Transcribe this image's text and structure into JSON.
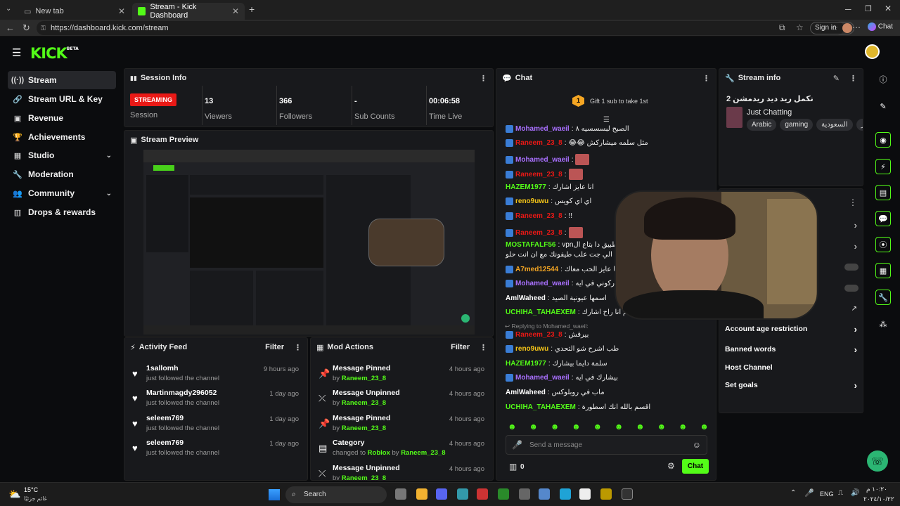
{
  "browser": {
    "tabs": [
      {
        "title": "New tab"
      },
      {
        "title": "Stream - Kick Dashboard"
      }
    ],
    "url": "https://dashboard.kick.com/stream",
    "sign_in": "Sign in",
    "chat_btn": "Chat"
  },
  "logo": {
    "text": "KICK",
    "beta": "BETA"
  },
  "sidebar": {
    "items": [
      {
        "label": "Stream",
        "icon": "broadcast-icon"
      },
      {
        "label": "Stream URL & Key",
        "icon": "link-icon"
      },
      {
        "label": "Revenue",
        "icon": "money-icon"
      },
      {
        "label": "Achievements",
        "icon": "trophy-icon"
      },
      {
        "label": "Studio",
        "icon": "grid-icon"
      },
      {
        "label": "Moderation",
        "icon": "wrench-icon"
      },
      {
        "label": "Community",
        "icon": "people-icon"
      },
      {
        "label": "Drops & rewards",
        "icon": "gift-icon"
      }
    ]
  },
  "session": {
    "title": "Session Info",
    "status": "STREAMING",
    "status_label": "Session",
    "stats": [
      {
        "value": "13",
        "label": "Viewers"
      },
      {
        "value": "366",
        "label": "Followers"
      },
      {
        "value": "-",
        "label": "Sub Counts"
      },
      {
        "value": "00:06:58",
        "label": "Time Live"
      }
    ]
  },
  "preview": {
    "title": "Stream Preview"
  },
  "activity": {
    "title": "Activity Feed",
    "filter": "Filter",
    "items": [
      {
        "name": "1sallomh",
        "sub": "just followed the channel",
        "time": "9 hours ago"
      },
      {
        "name": "Martinmagdy296052",
        "sub": "just followed the channel",
        "time": "1 day ago"
      },
      {
        "name": "seleem769",
        "sub": "just followed the channel",
        "time": "1 day ago"
      },
      {
        "name": "seleem769",
        "sub": "just followed the channel",
        "time": "1 day ago"
      }
    ]
  },
  "mod": {
    "title": "Mod Actions",
    "filter": "Filter",
    "items": [
      {
        "action": "Message Pinned",
        "prefix": "by",
        "user": "Raneem_23_8",
        "time": "4 hours ago"
      },
      {
        "action": "Message Unpinned",
        "prefix": "by",
        "user": "Raneem_23_8",
        "time": "4 hours ago"
      },
      {
        "action": "Message Pinned",
        "prefix": "by",
        "user": "Raneem_23_8",
        "time": "4 hours ago"
      },
      {
        "action": "Category",
        "prefix": "changed to",
        "cat": "Roblox",
        "by": "by",
        "user": "Raneem_23_8",
        "time": "4 hours ago"
      },
      {
        "action": "Message Unpinned",
        "prefix": "by",
        "user": "Raneem_23_8",
        "time": "4 hours ago"
      }
    ]
  },
  "chat": {
    "title": "Chat",
    "gift_count": "1",
    "gift_text": "Gift 1 sub to take 1st",
    "messages": [
      {
        "user": "Mohamed_waeil",
        "color": "#a970ff",
        "text": "الصبح لبسسسيه ٨"
      },
      {
        "user": "Raneem_23_8",
        "color": "#e91916",
        "text": "😂😂 مثل سلمه ميشاركش"
      },
      {
        "user": "Mohamed_waeil",
        "color": "#a970ff",
        "text": ""
      },
      {
        "user": "Raneem_23_8",
        "color": "#e91916",
        "text": ""
      },
      {
        "user": "HAZEM1977",
        "color": "#53fc18",
        "text": "انا عايز اشارك"
      },
      {
        "user": "reno9uwu",
        "color": "#f5c518",
        "text": "اي اي كويس"
      },
      {
        "user": "Raneem_23_8",
        "color": "#e91916",
        "text": "!!"
      },
      {
        "user": "Raneem_23_8",
        "color": "#e91916",
        "text": ""
      },
      {
        "user": "MOSTAFALF56",
        "color": "#53fc18",
        "text": "vpnواسطا التطبيق دا بتاع ال"
      },
      {
        "user": "",
        "color": "#fff",
        "text": "الي جت علب طيفونك مع ان انت حلو"
      },
      {
        "user": "A7med12544",
        "color": "#f5a623",
        "text": "انا عايز الحب معاك"
      },
      {
        "user": "Mohamed_waeil",
        "color": "#a970ff",
        "text": "شاركوني في ايه"
      },
      {
        "user": "AmlWaheed",
        "color": "#fff",
        "text": "اسمها عيونية الصيد"
      },
      {
        "user": "UCHIHA_TAHAEXEM",
        "color": "#53fc18",
        "text": "المهم انا راح اشارك"
      },
      {
        "user": "Raneem_23_8",
        "color": "#e91916",
        "text": "بيرقش"
      },
      {
        "user": "reno9uwu",
        "color": "#f5c518",
        "text": "طب اشرح شو التحدي"
      },
      {
        "user": "HAZEM1977",
        "color": "#53fc18",
        "text": "سلمة دايما بيشارك"
      },
      {
        "user": "Mohamed_waeil",
        "color": "#a970ff",
        "text": "بيشارك في ايه"
      },
      {
        "user": "AmlWaheed",
        "color": "#fff",
        "text": "ماب في روبلوكس"
      },
      {
        "user": "UCHIHA_TAHAEXEM",
        "color": "#53fc18",
        "text": "اقسم بالله انك اسطورة"
      }
    ],
    "reply_note": "Replying to Mohamed_waeil:",
    "placeholder": "Send a message",
    "count": "0",
    "send": "Chat"
  },
  "stream_info": {
    "title": "Stream info",
    "stream_title": "نكمل ريد ديد ريدمشن 2",
    "category": "Just Chatting",
    "tags": [
      "Arabic",
      "gaming",
      "السعودية",
      "مصر"
    ]
  },
  "settings": {
    "rows": [
      {
        "label": "Account age restriction"
      },
      {
        "label": "Banned words"
      },
      {
        "label": "Host Channel"
      },
      {
        "label": "Set goals"
      }
    ]
  },
  "taskbar": {
    "weather_temp": "15°C",
    "weather_text": "غائم جزئيًا",
    "search": "Search",
    "lang": "ENG",
    "time": "١٠:٢٠ م",
    "date": "٢٠٢٤/١٠/٢٢"
  }
}
